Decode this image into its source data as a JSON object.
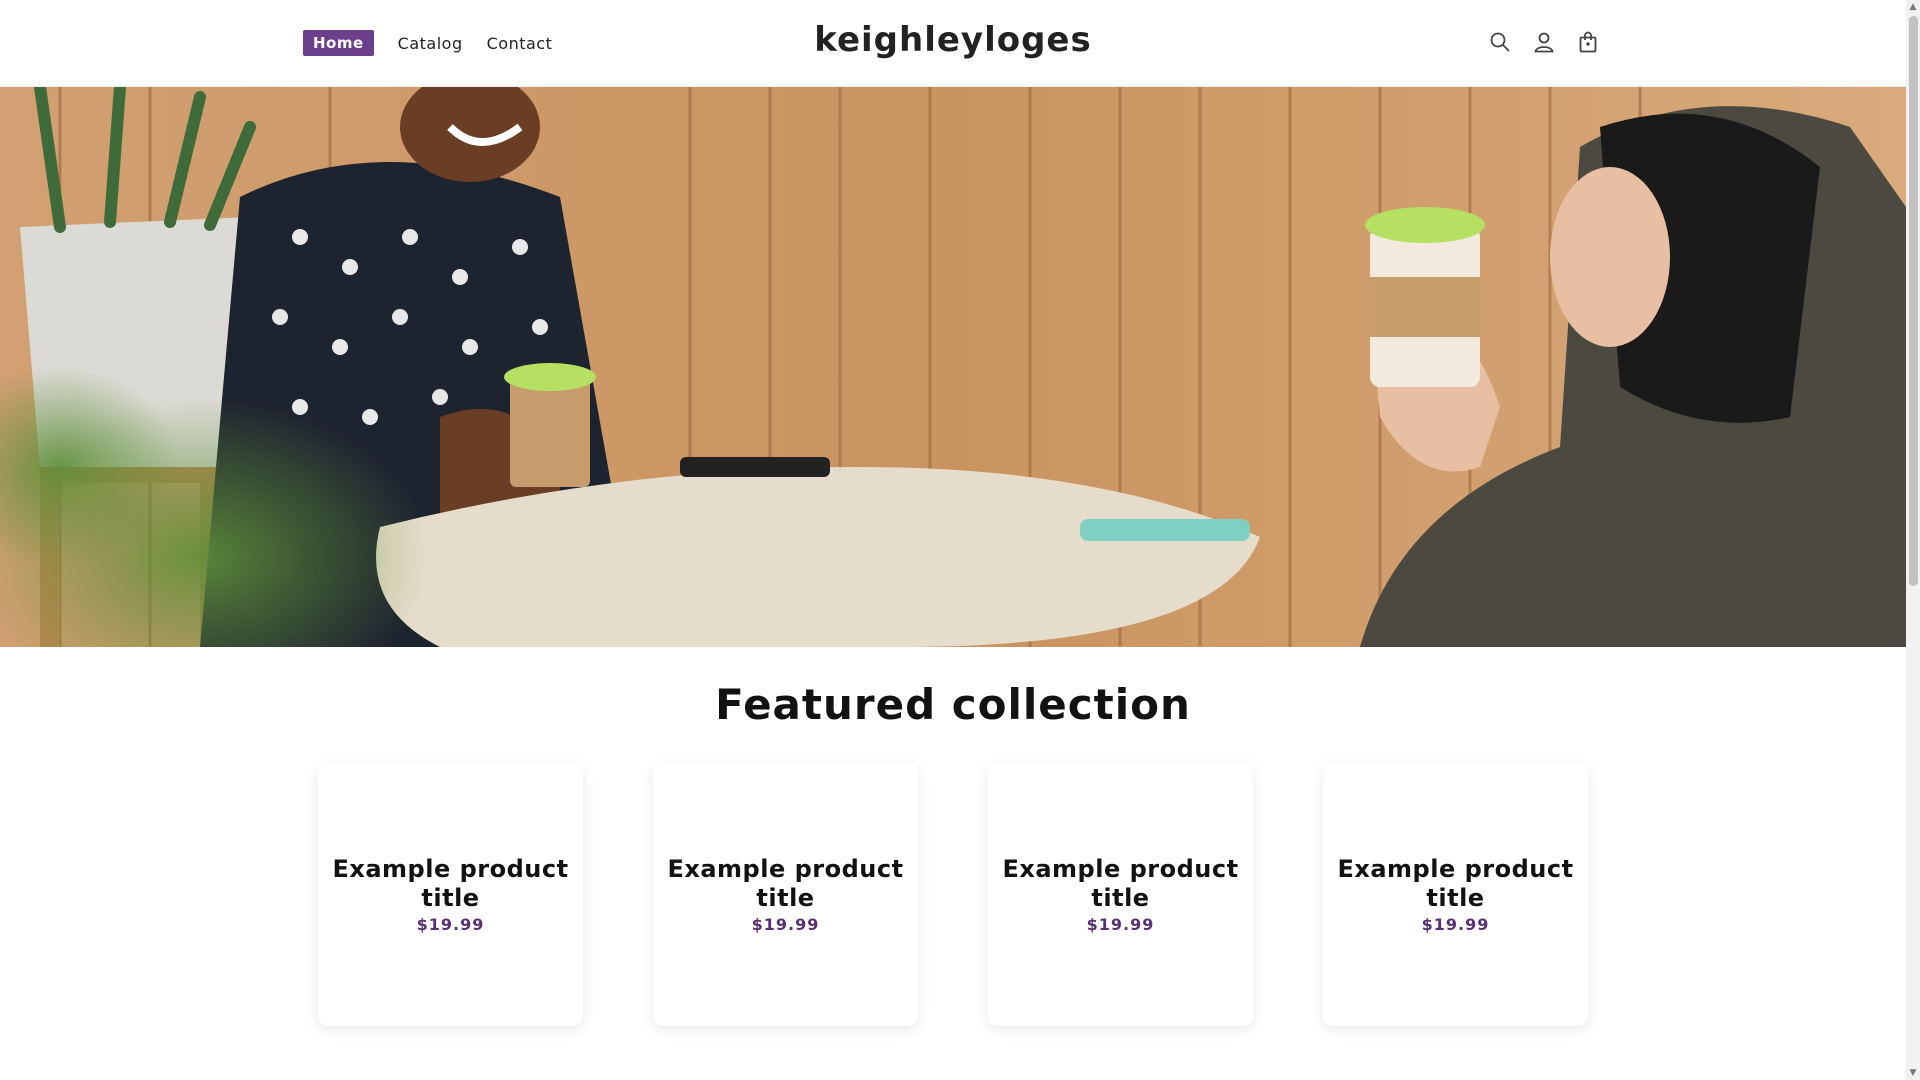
{
  "header": {
    "nav": [
      {
        "label": "Home"
      },
      {
        "label": "Catalog"
      },
      {
        "label": "Contact"
      }
    ],
    "logo": "keighleyloges",
    "icons": [
      "search-icon",
      "account-icon",
      "cart-icon"
    ]
  },
  "featured": {
    "title": "Featured collection",
    "products": [
      {
        "title": "Example product title",
        "price": "$19.99"
      },
      {
        "title": "Example product title",
        "price": "$19.99"
      },
      {
        "title": "Example product title",
        "price": "$19.99"
      },
      {
        "title": "Example product title",
        "price": "$19.99"
      }
    ]
  },
  "colors": {
    "accent": "#6b3f8c",
    "price": "#5a2e74"
  }
}
